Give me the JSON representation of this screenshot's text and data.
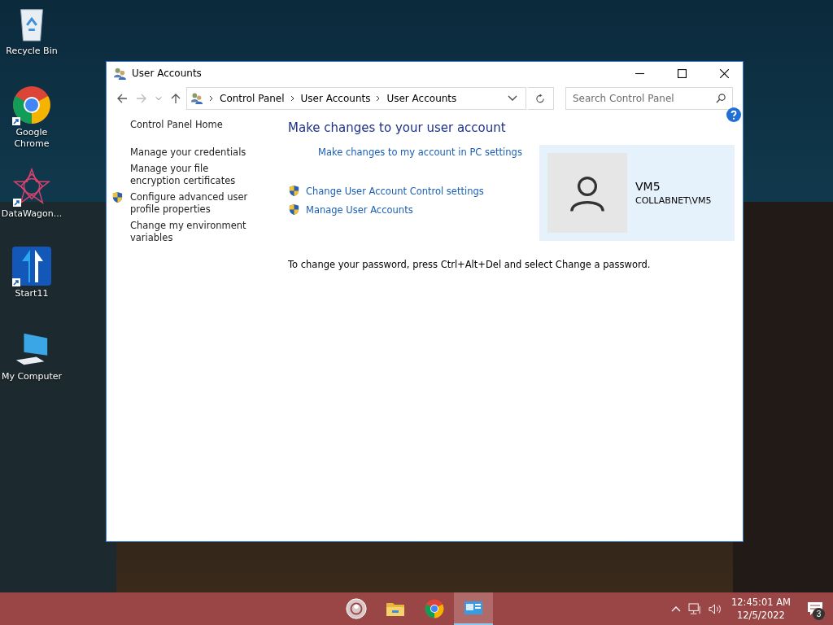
{
  "desktop_icons": [
    {
      "kind": "recycle",
      "label": "Recycle Bin",
      "shortcut": false
    },
    {
      "kind": "chrome",
      "label": "Google Chrome",
      "shortcut": true
    },
    {
      "kind": "star",
      "label": "DataWagon...",
      "shortcut": true
    },
    {
      "kind": "arrows",
      "label": "Start11",
      "shortcut": true
    },
    {
      "kind": "computer",
      "label": "My Computer",
      "shortcut": false
    }
  ],
  "window": {
    "title": "User Accounts",
    "breadcrumb": [
      "Control Panel",
      "User Accounts",
      "User Accounts"
    ],
    "search": {
      "placeholder": "Search Control Panel"
    },
    "sidebar": {
      "items": [
        {
          "label": "Control Panel Home",
          "shield": false
        },
        {
          "label": "Manage your credentials",
          "shield": false
        },
        {
          "label": "Manage your file encryption certificates",
          "shield": false
        },
        {
          "label": "Configure advanced user profile properties",
          "shield": true
        },
        {
          "label": "Change my environment variables",
          "shield": false
        }
      ]
    },
    "heading": "Make changes to your user account",
    "links": [
      {
        "label": "Make changes to my account in PC settings",
        "shield": false
      },
      {
        "label": "Change User Account Control settings",
        "shield": true
      },
      {
        "label": "Manage User Accounts",
        "shield": true
      }
    ],
    "account": {
      "name": "VM5",
      "domain": "COLLABNET\\VM5"
    },
    "note": "To change your password, press Ctrl+Alt+Del and select Change a password."
  },
  "taskbar": {
    "apps": [
      {
        "kind": "start",
        "selected": false
      },
      {
        "kind": "folder",
        "selected": false
      },
      {
        "kind": "chrome",
        "selected": false
      },
      {
        "kind": "panel",
        "selected": true
      }
    ],
    "clock": {
      "time": "12:45:01 AM",
      "date": "12/5/2022"
    },
    "notifications": "3"
  }
}
